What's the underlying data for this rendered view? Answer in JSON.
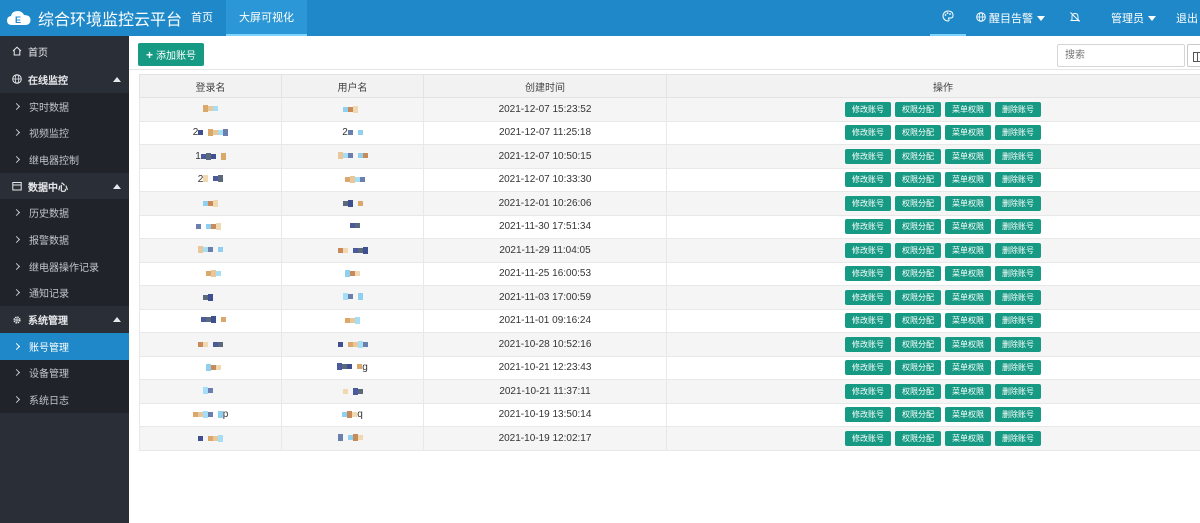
{
  "app": {
    "title": "综合环境监控云平台"
  },
  "nav": {
    "tabs": [
      {
        "label": "首页"
      },
      {
        "label": "大屏可视化"
      }
    ]
  },
  "top_right": {
    "alarm": "醒目告警",
    "user": "管理员",
    "logout": "退出"
  },
  "sidebar": {
    "home": "首页",
    "groups": [
      {
        "label": "在线监控",
        "items": [
          "实时数据",
          "视频监控",
          "继电器控制"
        ]
      },
      {
        "label": "数据中心",
        "items": [
          "历史数据",
          "报警数据",
          "继电器操作记录",
          "通知记录"
        ]
      },
      {
        "label": "系统管理",
        "items": [
          "账号管理",
          "设备管理",
          "系统日志"
        ]
      }
    ],
    "active_item": "账号管理"
  },
  "toolbar": {
    "add_label": "添加账号",
    "search_placeholder": "搜索"
  },
  "table": {
    "headers": [
      "登录名",
      "用户名",
      "创建时间",
      "操作"
    ],
    "actions": [
      "修改账号",
      "权限分配",
      "菜单权限",
      "删除账号"
    ],
    "rows": [
      {
        "login": "",
        "user": "",
        "created": "2021-12-07 15:23:52"
      },
      {
        "login": "2",
        "user": "2",
        "created": "2021-12-07 11:25:18"
      },
      {
        "login": "1",
        "user": "",
        "created": "2021-12-07 10:50:15"
      },
      {
        "login": "2",
        "user": "",
        "created": "2021-12-07 10:33:30"
      },
      {
        "login": "",
        "user": "",
        "created": "2021-12-01 10:26:06"
      },
      {
        "login": "",
        "user": "",
        "created": "2021-11-30 17:51:34"
      },
      {
        "login": "",
        "user": "",
        "created": "2021-11-29 11:04:05"
      },
      {
        "login": "",
        "user": "",
        "created": "2021-11-25 16:00:53"
      },
      {
        "login": "",
        "user": "",
        "created": "2021-11-03 17:00:59"
      },
      {
        "login": "",
        "user": "",
        "created": "2021-11-01 09:16:24"
      },
      {
        "login": "",
        "user": "",
        "created": "2021-10-28 10:52:16"
      },
      {
        "login": "",
        "user": "g",
        "created": "2021-10-21 12:23:43"
      },
      {
        "login": "",
        "user": "",
        "created": "2021-10-21 11:37:11"
      },
      {
        "login": "p",
        "user": "q",
        "created": "2021-10-19 13:50:14"
      },
      {
        "login": "",
        "user": "",
        "created": "2021-10-19 12:02:17"
      }
    ]
  },
  "colors": {
    "topbar": "#1e88c9",
    "sidebar": "#2a2e36",
    "accent": "#169a84",
    "active": "#1e88c9"
  },
  "icons": {
    "logo": "cloud-logo-icon",
    "theme": "palette-icon",
    "alarm": "globe-icon",
    "mute": "bell-slash-icon"
  }
}
